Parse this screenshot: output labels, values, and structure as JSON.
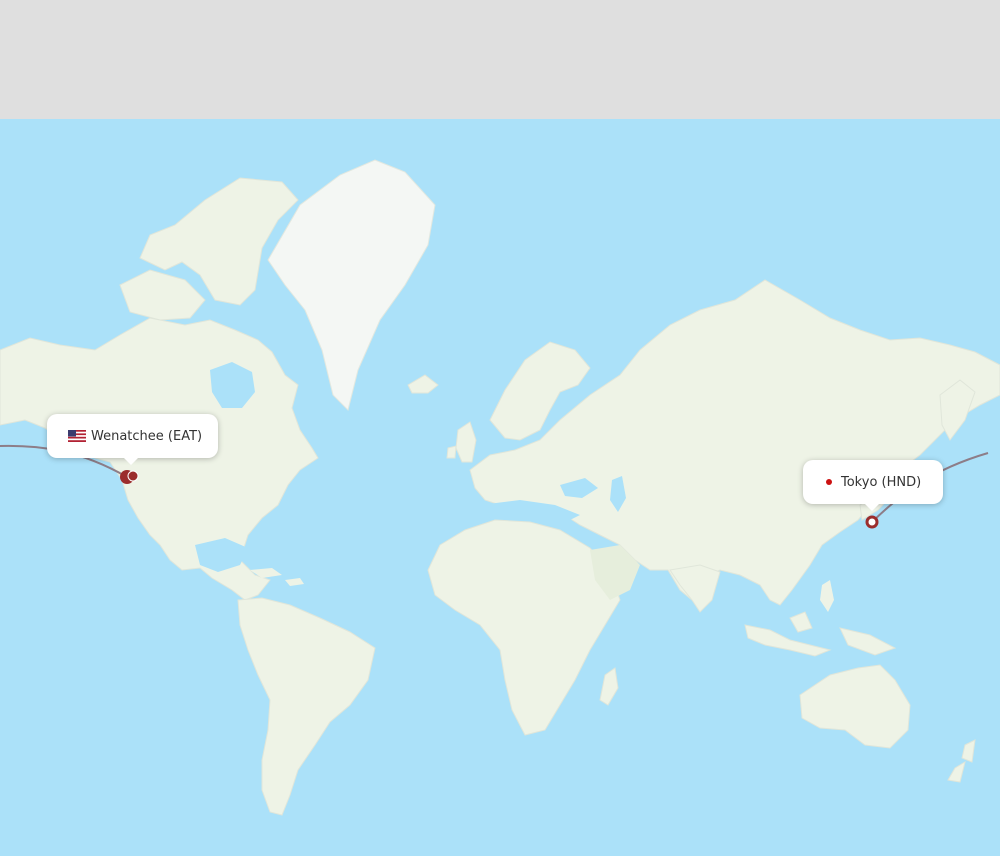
{
  "colors": {
    "water": "#abe1f9",
    "land": "#eef3e6",
    "land_alt": "#e6eedc",
    "ice": "#f4f7f4",
    "route": "#8d7d88",
    "marker": "#9b2d2d",
    "header_band": "#dfdfdf"
  },
  "origin": {
    "label": "Wenatchee (EAT)",
    "flag_icon": "us-flag-icon",
    "marker_icon": "map-pin-icon"
  },
  "destination": {
    "label": "Tokyo (HND)",
    "dot_icon": "red-dot-icon",
    "dot_color": "#cc1111",
    "marker_icon": "map-pin-icon"
  }
}
